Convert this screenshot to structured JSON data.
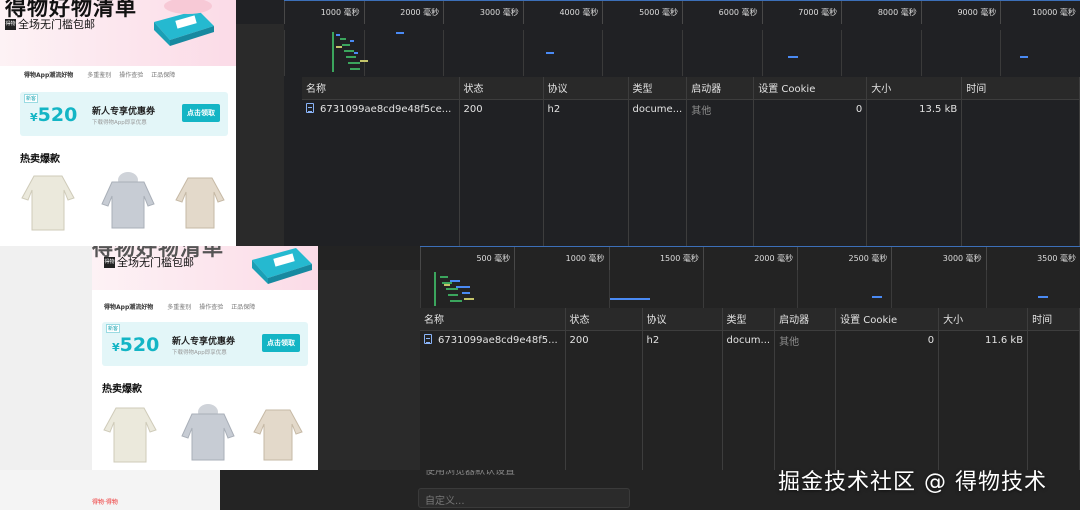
{
  "devtools_top": {
    "ruler_ticks": [
      "1000 毫秒",
      "2000 毫秒",
      "3000 毫秒",
      "4000 毫秒",
      "5000 毫秒",
      "6000 毫秒",
      "7000 毫秒",
      "8000 毫秒",
      "9000 毫秒",
      "10000 毫秒"
    ],
    "columns": [
      "名称",
      "状态",
      "协议",
      "类型",
      "启动器",
      "设置 Cookie",
      "大小",
      "时间"
    ],
    "row": {
      "name": "6731099ae8cd9e48f5ce...",
      "status": "200",
      "protocol": "h2",
      "type": "docume...",
      "initiator": "其他",
      "cookies": "0",
      "size": "13.5 kB",
      "time": ""
    }
  },
  "devtools_bottom": {
    "ruler_ticks": [
      "500 毫秒",
      "1000 毫秒",
      "1500 毫秒",
      "2000 毫秒",
      "2500 毫秒",
      "3000 毫秒",
      "3500 毫秒"
    ],
    "columns": [
      "名称",
      "状态",
      "协议",
      "类型",
      "启动器",
      "设置 Cookie",
      "大小",
      "时间"
    ],
    "row": {
      "name": "6731099ae8cd9e48f5...",
      "status": "200",
      "protocol": "h2",
      "type": "docum...",
      "initiator": "其他",
      "cookies": "0",
      "size": "11.6 kB",
      "time": ""
    }
  },
  "phone": {
    "banner_title": "得物好物清单",
    "banner_sub": "全场无门槛包邮",
    "sub_logo": "得物",
    "trust_brand": "得物App潮流好物",
    "trust_items": [
      "多重鉴别",
      "操作查验",
      "正品保障"
    ],
    "coupon_tag": "新客",
    "coupon_currency": "¥",
    "coupon_amount": "520",
    "coupon_title": "新人专享优惠券",
    "coupon_desc": "下载得物App即享优惠",
    "coupon_button": "点击领取",
    "hot_title": "热卖爆款"
  },
  "underlying": {
    "custom_select": "自定义...",
    "checkbox_label": "使用浏览器默认设置",
    "pink_text": "得物·得物"
  },
  "watermark": "掘金技术社区 @ 得物技术",
  "colors": {
    "accent": "#14b5c5",
    "devtools_bg": "#202124",
    "timeline_border": "#3c6fb8"
  }
}
